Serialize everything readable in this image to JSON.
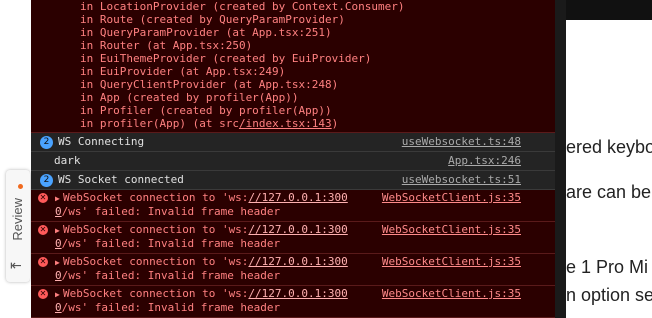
{
  "stack": [
    "in LocationProvider (created by Context.Consumer)",
    "in Route (created by QueryParamProvider)",
    "in QueryParamProvider (at App.tsx:251)",
    "in Router (at App.tsx:250)",
    "in EuiThemeProvider (created by EuiProvider)",
    "in EuiProvider (at App.tsx:249)",
    "in QueryClientProvider (at App.tsx:248)",
    "in App (created by profiler(App))",
    "in Profiler (created by profiler(App))"
  ],
  "stack_last": {
    "prefix": "in profiler(App) (at src",
    "link": "/index.tsx:143",
    "suffix": ")"
  },
  "rows": [
    {
      "count": "2",
      "msg": "WS Connecting",
      "src": "useWebsocket.ts:48"
    },
    {
      "count": "",
      "msg": "dark",
      "src": "App.tsx:246"
    },
    {
      "count": "2",
      "msg": "WS Socket connected",
      "src": "useWebsocket.ts:51"
    }
  ],
  "errors": [
    {
      "pre": "WebSocket connection to 'ws:",
      "url": "//127.0.0.1:300",
      "line2a": "0",
      "line2b": "/ws' failed: Invalid frame header",
      "src": "WebSocketClient.js:35"
    },
    {
      "pre": "WebSocket connection to 'ws:",
      "url": "//127.0.0.1:300",
      "line2a": "0",
      "line2b": "/ws' failed: Invalid frame header",
      "src": "WebSocketClient.js:35"
    },
    {
      "pre": "WebSocket connection to 'ws:",
      "url": "//127.0.0.1:300",
      "line2a": "0",
      "line2b": "/ws' failed: Invalid frame header",
      "src": "WebSocketClient.js:35"
    },
    {
      "pre": "WebSocket connection to 'ws:",
      "url": "//127.0.0.1:300",
      "line2a": "0",
      "line2b": "/ws' failed: Invalid frame header",
      "src": "WebSocketClient.js:35"
    }
  ],
  "review": {
    "label": "Review",
    "arrow": "⇤"
  },
  "page_text": [
    "ered keybo",
    "are can be",
    "e 1 Pro Mi",
    "n option se"
  ]
}
